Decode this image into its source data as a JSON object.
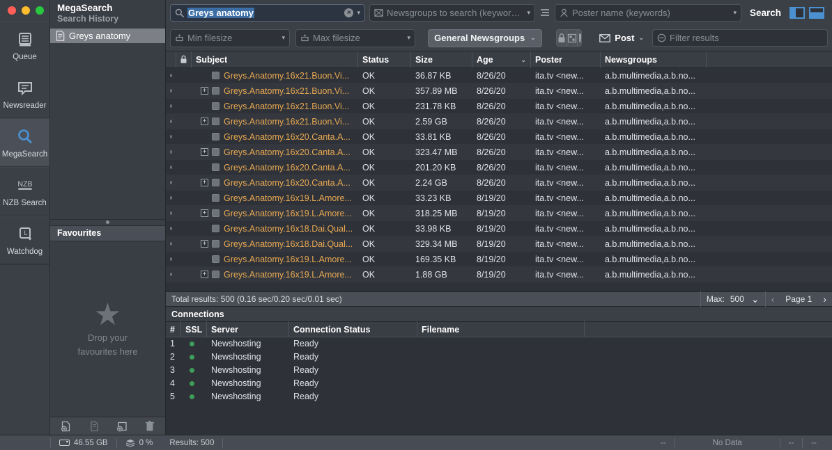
{
  "window": {
    "traffic_lights": [
      "close",
      "minimize",
      "maximize"
    ]
  },
  "rail": {
    "items": [
      {
        "label": "Queue",
        "icon": "queue-icon",
        "active": false
      },
      {
        "label": "Newsreader",
        "icon": "newsreader-icon",
        "active": false
      },
      {
        "label": "MegaSearch",
        "icon": "magnifier-icon",
        "active": true
      },
      {
        "label": "NZB Search",
        "icon": "nzb-icon",
        "active": false
      },
      {
        "label": "Watchdog",
        "icon": "watchdog-icon",
        "active": false
      }
    ]
  },
  "sidebar": {
    "title": "MegaSearch",
    "subtitle": "Search History",
    "history": [
      {
        "label": "Greys anatomy",
        "selected": true
      }
    ],
    "favourites": {
      "header": "Favourites",
      "empty_line1": "Drop your",
      "empty_line2": "favourites here",
      "star": "★"
    },
    "tools": [
      {
        "name": "add-nzb-icon",
        "enabled": true
      },
      {
        "name": "copy-icon",
        "enabled": false
      },
      {
        "name": "add-folder-icon",
        "enabled": true
      },
      {
        "name": "trash-icon",
        "enabled": true
      }
    ]
  },
  "toolbar": {
    "search": {
      "value": "Greys anatomy",
      "icon": "search-icon",
      "clear": "×",
      "caret": "▾"
    },
    "newsgroups": {
      "placeholder": "Newsgroups to search (keywords)",
      "icon": "newsgroup-icon",
      "caret": "▾",
      "list_icon": "list-icon"
    },
    "poster": {
      "placeholder": "Poster name (keywords)",
      "icon": "person-icon",
      "caret": "▾"
    },
    "search_button": "Search",
    "panel_buttons": [
      {
        "name": "toggle-sidebar-button"
      },
      {
        "name": "toggle-bottom-panel-button"
      }
    ],
    "min_filesize": {
      "placeholder": "Min filesize",
      "icon": "min-size-icon",
      "caret": "▾"
    },
    "max_filesize": {
      "placeholder": "Max filesize",
      "icon": "max-size-icon",
      "caret": "▾"
    },
    "category": {
      "label": "General Newsgroups",
      "caret": "⌄"
    },
    "segment_buttons": [
      {
        "name": "lock-icon"
      },
      {
        "name": "puzzle-icon"
      },
      {
        "name": "document-icon"
      }
    ],
    "post": {
      "label": "Post",
      "icon": "envelope-icon",
      "caret": "⌄"
    },
    "filter": {
      "placeholder": "Filter results",
      "icon": "filter-icon"
    }
  },
  "results_table": {
    "columns": [
      "",
      "",
      "Subject",
      "Status",
      "Size",
      "Age",
      "Poster",
      "Newsgroups"
    ],
    "sort_column": "Age",
    "sort_caret": "⌄",
    "lock_icon": "lock-icon",
    "rows": [
      {
        "expandable": false,
        "subject": "Greys.Anatomy.16x21.Buon.Vi...",
        "status": "OK",
        "size": "36.87 KB",
        "age": "8/26/20",
        "poster": "ita.tv <new...",
        "newsgroups": "a.b.multimedia,a.b.no..."
      },
      {
        "expandable": true,
        "subject": "Greys.Anatomy.16x21.Buon.Vi...",
        "status": "OK",
        "size": "357.89 MB",
        "age": "8/26/20",
        "poster": "ita.tv <new...",
        "newsgroups": "a.b.multimedia,a.b.no..."
      },
      {
        "expandable": false,
        "subject": "Greys.Anatomy.16x21.Buon.Vi...",
        "status": "OK",
        "size": "231.78 KB",
        "age": "8/26/20",
        "poster": "ita.tv <new...",
        "newsgroups": "a.b.multimedia,a.b.no..."
      },
      {
        "expandable": true,
        "subject": "Greys.Anatomy.16x21.Buon.Vi...",
        "status": "OK",
        "size": "2.59 GB",
        "age": "8/26/20",
        "poster": "ita.tv <new...",
        "newsgroups": "a.b.multimedia,a.b.no..."
      },
      {
        "expandable": false,
        "subject": "Greys.Anatomy.16x20.Canta.A...",
        "status": "OK",
        "size": "33.81 KB",
        "age": "8/26/20",
        "poster": "ita.tv <new...",
        "newsgroups": "a.b.multimedia,a.b.no..."
      },
      {
        "expandable": true,
        "subject": "Greys.Anatomy.16x20.Canta.A...",
        "status": "OK",
        "size": "323.47 MB",
        "age": "8/26/20",
        "poster": "ita.tv <new...",
        "newsgroups": "a.b.multimedia,a.b.no..."
      },
      {
        "expandable": false,
        "subject": "Greys.Anatomy.16x20.Canta.A...",
        "status": "OK",
        "size": "201.20 KB",
        "age": "8/26/20",
        "poster": "ita.tv <new...",
        "newsgroups": "a.b.multimedia,a.b.no..."
      },
      {
        "expandable": true,
        "subject": "Greys.Anatomy.16x20.Canta.A...",
        "status": "OK",
        "size": "2.24 GB",
        "age": "8/26/20",
        "poster": "ita.tv <new...",
        "newsgroups": "a.b.multimedia,a.b.no..."
      },
      {
        "expandable": false,
        "subject": "Greys.Anatomy.16x19.L.Amore...",
        "status": "OK",
        "size": "33.23 KB",
        "age": "8/19/20",
        "poster": "ita.tv <new...",
        "newsgroups": "a.b.multimedia,a.b.no..."
      },
      {
        "expandable": true,
        "subject": "Greys.Anatomy.16x19.L.Amore...",
        "status": "OK",
        "size": "318.25 MB",
        "age": "8/19/20",
        "poster": "ita.tv <new...",
        "newsgroups": "a.b.multimedia,a.b.no..."
      },
      {
        "expandable": false,
        "subject": "Greys.Anatomy.16x18.Dai.Qual...",
        "status": "OK",
        "size": "33.98 KB",
        "age": "8/19/20",
        "poster": "ita.tv <new...",
        "newsgroups": "a.b.multimedia,a.b.no..."
      },
      {
        "expandable": true,
        "subject": "Greys.Anatomy.16x18.Dai.Qual...",
        "status": "OK",
        "size": "329.34 MB",
        "age": "8/19/20",
        "poster": "ita.tv <new...",
        "newsgroups": "a.b.multimedia,a.b.no..."
      },
      {
        "expandable": false,
        "subject": "Greys.Anatomy.16x19.L.Amore...",
        "status": "OK",
        "size": "169.35 KB",
        "age": "8/19/20",
        "poster": "ita.tv <new...",
        "newsgroups": "a.b.multimedia,a.b.no..."
      },
      {
        "expandable": true,
        "subject": "Greys.Anatomy.16x19.L.Amore...",
        "status": "OK",
        "size": "1.88 GB",
        "age": "8/19/20",
        "poster": "ita.tv <new...",
        "newsgroups": "a.b.multimedia,a.b.no..."
      }
    ]
  },
  "results_bar": {
    "total": "Total results: 500 (0.16 sec/0.20 sec/0.01 sec)",
    "max_label": "Max:",
    "max_value": "500",
    "max_caret": "⌄",
    "prev": "‹",
    "page": "Page 1",
    "next": "›"
  },
  "connections": {
    "header": "Connections",
    "columns": [
      "#",
      "SSL",
      "Server",
      "Connection Status",
      "Filename"
    ],
    "rows": [
      {
        "num": "1",
        "ssl": true,
        "server": "Newshosting",
        "status": "Ready",
        "filename": ""
      },
      {
        "num": "2",
        "ssl": true,
        "server": "Newshosting",
        "status": "Ready",
        "filename": ""
      },
      {
        "num": "3",
        "ssl": true,
        "server": "Newshosting",
        "status": "Ready",
        "filename": ""
      },
      {
        "num": "4",
        "ssl": true,
        "server": "Newshosting",
        "status": "Ready",
        "filename": ""
      },
      {
        "num": "5",
        "ssl": true,
        "server": "Newshosting",
        "status": "Ready",
        "filename": ""
      }
    ]
  },
  "statusbar": {
    "disk_space": "46.55 GB",
    "disk_icon": "hdd-icon",
    "cpu_usage": "0 %",
    "cpu_icon": "stack-icon",
    "results": "Results: 500",
    "speed_left": "--",
    "graph": "No Data",
    "speed_mid": "--",
    "speed_right": "--"
  },
  "colors": {
    "accent": "#4b91d1",
    "subject": "#e7a752",
    "ssl_ok": "#3e9e58",
    "selection": "#3c6ea5"
  }
}
